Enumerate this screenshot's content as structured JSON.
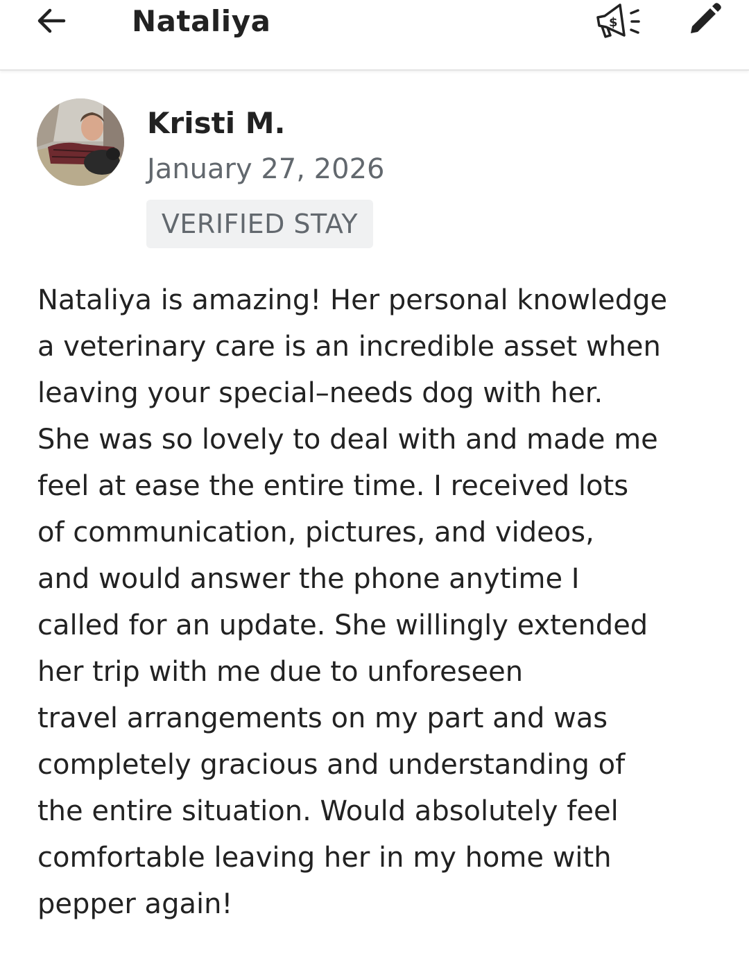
{
  "header": {
    "title": "Nataliya",
    "back_icon": "arrow-left-icon",
    "promo_icon": "megaphone-dollar-icon",
    "edit_icon": "pencil-icon"
  },
  "review": {
    "reviewer_name": "Kristi M.",
    "date": "January 27, 2026",
    "badge": "VERIFIED STAY",
    "body_lines": [
      "Nataliya is amazing! Her personal knowledge",
      "a veterinary care is an incredible asset when",
      "leaving your special–needs dog with her.",
      "She was so lovely to deal with and made me",
      "feel at ease the entire time. I received lots",
      "of communication, pictures, and videos,",
      "and would answer the phone anytime I",
      "called for an update. She willingly extended",
      "her trip with me due to unforeseen",
      "travel arrangements on my part and was",
      "completely gracious and understanding of",
      "the entire situation. Would absolutely feel",
      "comfortable leaving her in my home with",
      "pepper again!"
    ]
  },
  "colors": {
    "text_primary": "#222222",
    "text_secondary": "#62686e",
    "badge_background": "#f0f1f2",
    "header_border": "#e4e4e4"
  }
}
